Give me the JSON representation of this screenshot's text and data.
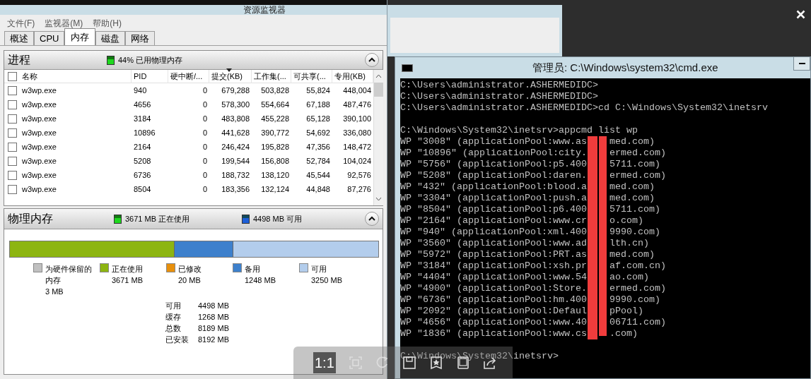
{
  "monitor": {
    "title": "资源监视器",
    "menu": [
      "文件(F)",
      "监视器(M)",
      "帮助(H)"
    ],
    "tabs": [
      {
        "label": "概述",
        "selected": false
      },
      {
        "label": "CPU",
        "selected": false
      },
      {
        "label": "内存",
        "selected": true
      },
      {
        "label": "磁盘",
        "selected": false
      },
      {
        "label": "网络",
        "selected": false
      }
    ],
    "processes": {
      "title": "进程",
      "summary": "44% 已用物理内存",
      "expanded": true,
      "all_checked": false,
      "columns": [
        {
          "label": "名称",
          "sorted": false
        },
        {
          "label": "PID",
          "sorted": false
        },
        {
          "label": "硬中断/...",
          "sorted": false
        },
        {
          "label": "提交(KB)",
          "sorted": true
        },
        {
          "label": "工作集(...",
          "sorted": false
        },
        {
          "label": "可共享(...",
          "sorted": false
        },
        {
          "label": "专用(KB)",
          "sorted": false
        }
      ],
      "rows": [
        {
          "checked": false,
          "cells": [
            "w3wp.exe",
            "940",
            "0",
            "679,288",
            "503,828",
            "55,824",
            "448,004"
          ]
        },
        {
          "checked": false,
          "cells": [
            "w3wp.exe",
            "4656",
            "0",
            "578,300",
            "554,664",
            "67,188",
            "487,476"
          ]
        },
        {
          "checked": false,
          "cells": [
            "w3wp.exe",
            "3184",
            "0",
            "483,808",
            "455,228",
            "65,128",
            "390,100"
          ]
        },
        {
          "checked": false,
          "cells": [
            "w3wp.exe",
            "10896",
            "0",
            "441,628",
            "390,772",
            "54,692",
            "336,080"
          ]
        },
        {
          "checked": false,
          "cells": [
            "w3wp.exe",
            "2164",
            "0",
            "246,424",
            "195,828",
            "47,356",
            "148,472"
          ]
        },
        {
          "checked": false,
          "cells": [
            "w3wp.exe",
            "5208",
            "0",
            "199,544",
            "156,808",
            "52,784",
            "104,024"
          ]
        },
        {
          "checked": false,
          "cells": [
            "w3wp.exe",
            "6736",
            "0",
            "188,732",
            "138,120",
            "45,544",
            "92,576"
          ]
        },
        {
          "checked": false,
          "cells": [
            "w3wp.exe",
            "8504",
            "0",
            "183,356",
            "132,124",
            "44,848",
            "87,276"
          ]
        }
      ]
    },
    "physical_memory": {
      "title": "物理内存",
      "in_use": "3671 MB 正在使用",
      "available": "4498 MB 可用",
      "expanded": true,
      "usage_bar": {
        "in_use": {
          "level": 0.448,
          "color": "#8db511"
        },
        "free": {
          "level": 0.395,
          "color": "#b3cdec"
        }
      },
      "legend": [
        {
          "label": "为硬件保留的内存",
          "value": "3 MB",
          "color": "#c0c0c0"
        },
        {
          "label": "正在使用",
          "value": "3671 MB",
          "color": "#8db511"
        },
        {
          "label": "已修改",
          "value": "20 MB",
          "color": "#e8900c"
        },
        {
          "label": "备用",
          "value": "1248 MB",
          "color": "#3d80cc"
        },
        {
          "label": "可用",
          "value": "3250 MB",
          "color": "#b3cdec"
        }
      ],
      "stats": [
        {
          "label": "可用",
          "value": "4498 MB"
        },
        {
          "label": "缓存",
          "value": "1268 MB"
        },
        {
          "label": "总数",
          "value": "8189 MB"
        },
        {
          "label": "已安装",
          "value": "8192 MB"
        }
      ]
    }
  },
  "console": {
    "title": "管理员: C:\\Windows\\system32\\cmd.exe",
    "lines": [
      {
        "kind": "text",
        "text": "C:\\Users\\administrator.ASHERMEDIDC>"
      },
      {
        "kind": "text",
        "text": "C:\\Users\\administrator.ASHERMEDIDC>"
      },
      {
        "kind": "text",
        "text": "C:\\Users\\administrator.ASHERMEDIDC>cd C:\\Windows\\System32\\inetsrv"
      },
      {
        "kind": "blank"
      },
      {
        "kind": "text",
        "text": "C:\\Windows\\System32\\inetsrv>appcmd list wp"
      },
      {
        "kind": "redacted",
        "left": "WP \"3008\" (applicationPool:www.as",
        "right": "med.com)"
      },
      {
        "kind": "redacted",
        "left": "WP \"10896\" (applicationPool:city.",
        "right": "ermed.com)"
      },
      {
        "kind": "redacted",
        "left": "WP \"5756\" (applicationPool:p5.400",
        "right": "5711.com)"
      },
      {
        "kind": "redacted",
        "left": "WP \"5208\" (applicationPool:daren.",
        "right": "ermed.com)"
      },
      {
        "kind": "redacted",
        "left": "WP \"432\" (applicationPool:blood.a",
        "right": "med.com)"
      },
      {
        "kind": "redacted",
        "left": "WP \"3304\" (applicationPool:push.a",
        "right": "med.com)"
      },
      {
        "kind": "redacted",
        "left": "WP \"8504\" (applicationPool:p6.400",
        "right": "5711.com)"
      },
      {
        "kind": "redacted",
        "left": "WP \"2164\" (applicationPool:www.cr",
        "right": "o.com)"
      },
      {
        "kind": "redacted",
        "left": "WP \"940\" (applicationPool:xml.400",
        "right": "9990.com)"
      },
      {
        "kind": "redacted",
        "left": "WP \"3560\" (applicationPool:www.ad",
        "right": "lth.cn)"
      },
      {
        "kind": "redacted",
        "left": "WP \"5972\" (applicationPool:PRT.as",
        "right": "med.com)"
      },
      {
        "kind": "redacted",
        "left": "WP \"3184\" (applicationPool:xsh.pr",
        "right": "af.com.cn)"
      },
      {
        "kind": "redacted",
        "left": "WP \"4404\" (applicationPool:www.54",
        "right": "ao.com)"
      },
      {
        "kind": "redacted",
        "left": "WP \"4900\" (applicationPool:Store.",
        "right": "ermed.com)"
      },
      {
        "kind": "redacted",
        "left": "WP \"6736\" (applicationPool:hm.400",
        "right": "9990.com)"
      },
      {
        "kind": "redacted",
        "left": "WP \"2092\" (applicationPool:Defaul",
        "right": "pPool)"
      },
      {
        "kind": "redacted",
        "left": "WP \"4656\" (applicationPool:www.40",
        "right": "06711.com)"
      },
      {
        "kind": "redacted",
        "left": "WP \"1836\" (applicationPool:www.cs",
        "right": ".com)"
      },
      {
        "kind": "blank"
      },
      {
        "kind": "text",
        "text": "C:\\Windows\\System32\\inetsrv>"
      }
    ]
  },
  "viewer_toolbar": {
    "zoom_label": "1:1"
  }
}
